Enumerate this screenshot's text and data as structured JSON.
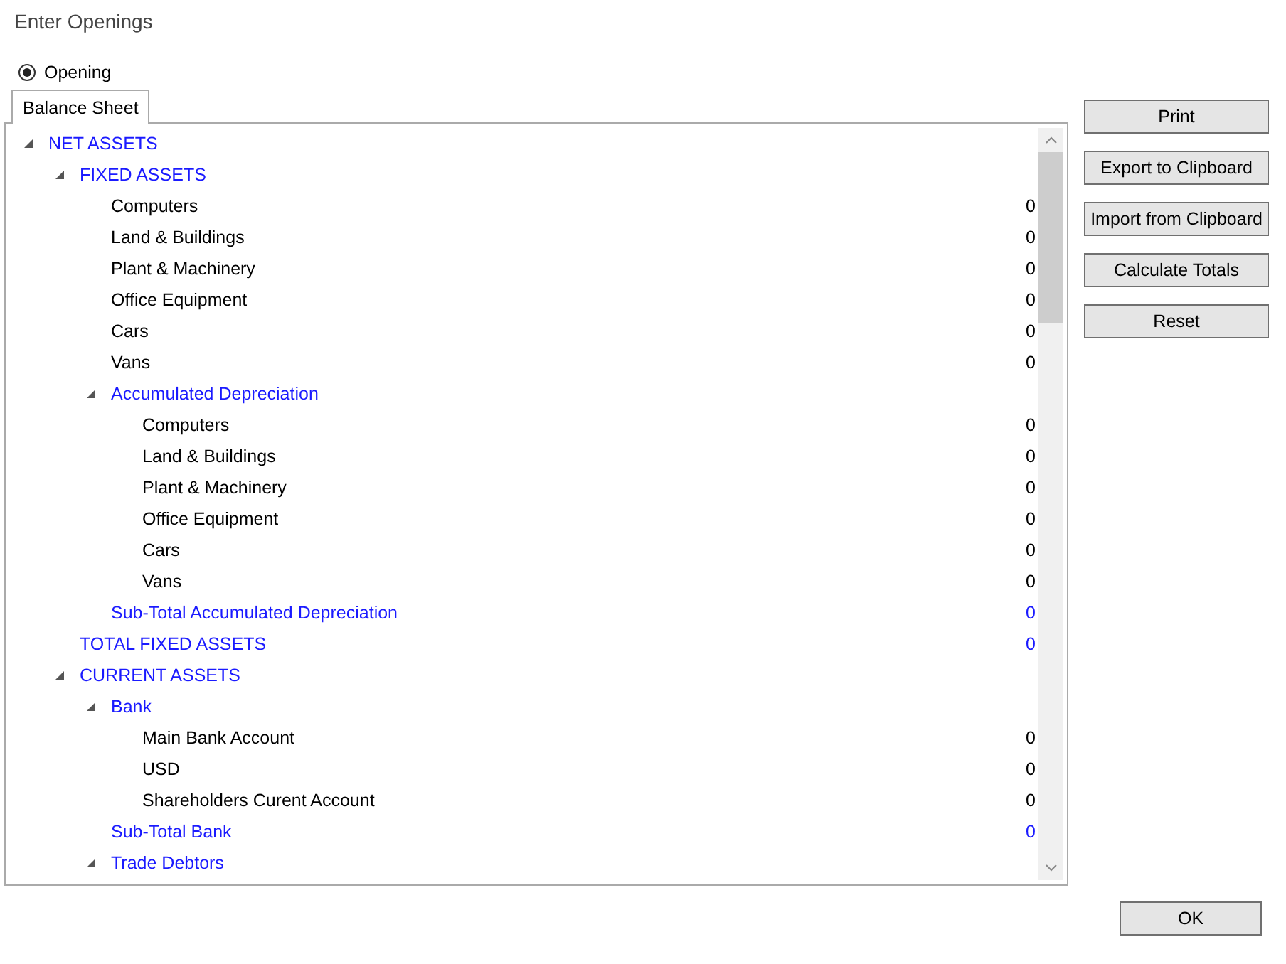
{
  "window": {
    "title": "Enter Openings"
  },
  "radios": [
    {
      "label": "Opening",
      "selected": true
    }
  ],
  "tabs": [
    {
      "label": "Balance Sheet",
      "selected": true
    }
  ],
  "tree": [
    {
      "kind": "group",
      "label": "NET ASSETS",
      "expanded": true,
      "children": [
        {
          "kind": "group",
          "label": "FIXED ASSETS",
          "expanded": true,
          "children": [
            {
              "kind": "item",
              "label": "Computers",
              "value": "0"
            },
            {
              "kind": "item",
              "label": "Land & Buildings",
              "value": "0"
            },
            {
              "kind": "item",
              "label": "Plant & Machinery",
              "value": "0"
            },
            {
              "kind": "item",
              "label": "Office Equipment",
              "value": "0"
            },
            {
              "kind": "item",
              "label": "Cars",
              "value": "0"
            },
            {
              "kind": "item",
              "label": "Vans",
              "value": "0"
            },
            {
              "kind": "group",
              "label": "Accumulated Depreciation",
              "expanded": true,
              "children": [
                {
                  "kind": "item",
                  "label": "Computers",
                  "value": "0"
                },
                {
                  "kind": "item",
                  "label": "Land & Buildings",
                  "value": "0"
                },
                {
                  "kind": "item",
                  "label": "Plant & Machinery",
                  "value": "0"
                },
                {
                  "kind": "item",
                  "label": "Office Equipment",
                  "value": "0"
                },
                {
                  "kind": "item",
                  "label": "Cars",
                  "value": "0"
                },
                {
                  "kind": "item",
                  "label": "Vans",
                  "value": "0"
                }
              ]
            },
            {
              "kind": "total",
              "label": "Sub-Total Accumulated Depreciation",
              "value": "0"
            }
          ]
        },
        {
          "kind": "total",
          "label": "TOTAL FIXED ASSETS",
          "value": "0"
        },
        {
          "kind": "group",
          "label": "CURRENT ASSETS",
          "expanded": true,
          "children": [
            {
              "kind": "group",
              "label": "Bank",
              "expanded": true,
              "children": [
                {
                  "kind": "item",
                  "label": "Main Bank Account",
                  "value": "0"
                },
                {
                  "kind": "item",
                  "label": "USD",
                  "value": "0"
                },
                {
                  "kind": "item",
                  "label": "Shareholders Curent Account",
                  "value": "0"
                }
              ]
            },
            {
              "kind": "total",
              "label": "Sub-Total Bank",
              "value": "0"
            },
            {
              "kind": "group",
              "label": "Trade Debtors",
              "expanded": true
            }
          ]
        }
      ]
    }
  ],
  "buttons": [
    "Print",
    "Export to Clipboard",
    "Import from Clipboard",
    "Calculate Totals",
    "Reset"
  ],
  "footer_buttons": [
    "OK"
  ]
}
